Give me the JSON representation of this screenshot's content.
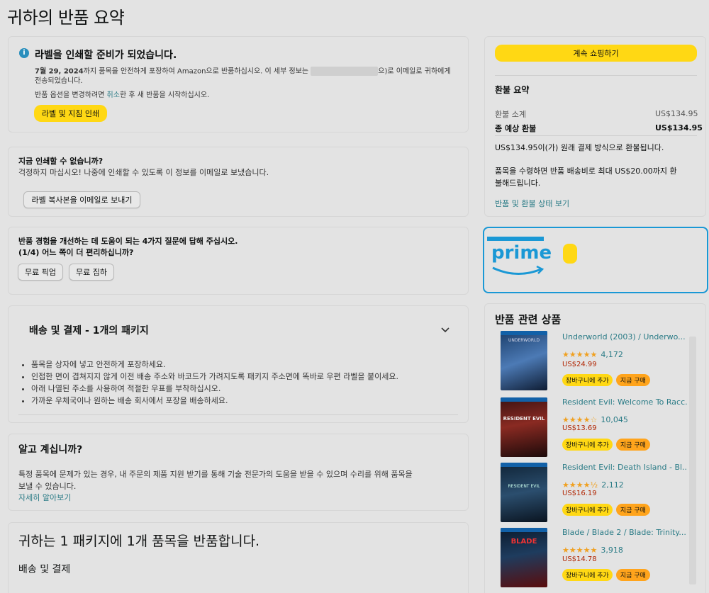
{
  "page": {
    "title": "귀하의 반품 요약"
  },
  "label_ready": {
    "heading": "라벨을 인쇄할 준비가 되었습니다.",
    "date": "7월 29, 2024",
    "line1_rest": "까지 품목을 안전하게 포장하여 Amazon으로 반품하십시오. 이 세부 정보는",
    "line1_end": "으)로 이메일로 귀하에게",
    "line2": "전송되었습니다.",
    "change_prefix": "반품 옵션을 변경하려면 ",
    "cancel_link": "취소",
    "change_suffix": "한 후 새 반품을 시작하십시오.",
    "print_button": "라벨 및 지침 인쇄"
  },
  "cant_print": {
    "heading": "지금 인쇄할 수 없습니까?",
    "text": "걱정하지 마십시오! 나중에 인쇄할 수 있도록 이 정보를 이메일로 보냈습니다.",
    "email_button": "라벨 복사본을 이메일로 보내기"
  },
  "survey": {
    "line1": "반품 경험을 개선하는 데 도움이 되는 4가지 질문에 답해 주십시오.",
    "line2": "(1/4) 어느 쪽이 더 편리하십니까?",
    "option1": "무료 픽업",
    "option2": "무료 집하"
  },
  "shipping": {
    "heading": "배송 및 결제 - 1개의 패키지",
    "bullets": [
      "품목을 상자에 넣고 안전하게 포장하세요.",
      "인접한 면이 겹쳐지지 않게 이전 배송 주소와 바코드가 가려지도록 패키지 주소면에 똑바로 우편 라벨을 붙이세요.",
      "아래 나열된 주소를 사용하여 적절한 우표를 부착하십시오.",
      "가까운 우체국이나 원하는 배송 회사에서 포장을 배송하세요."
    ]
  },
  "did_you_know": {
    "heading": "알고 계십니까?",
    "text1": "특정 품목에 문제가 있는 경우, 내 주문의 제품 지원 받기를 통해 기술 전문가의 도움을 받을 수 있으며 수리를 위해 품목을",
    "text2": "보낼 수 있습니다.",
    "link": "자세히 알아보기"
  },
  "returning": {
    "heading": "귀하는 1 패키지에 1개 품목을 반품합니다.",
    "sub": "배송 및 결제"
  },
  "summary": {
    "continue_button": "계속 쇼핑하기",
    "heading": "환불 요약",
    "subtotal_label": "환불 소계",
    "subtotal_value": "US$134.95",
    "total_label": "종 예상 환불",
    "total_value": "US$134.95",
    "refund_note": "US$134.95이(가) 원래 결제 방식으로 환불됩니다.",
    "shipping_note1": "품목을 수령하면 반품 배송비로 최대 US$20.00까지 환",
    "shipping_note2": "불해드립니다.",
    "status_link": "반품 및 환불 상태 보기"
  },
  "prime": {
    "logo_text": "prime"
  },
  "related": {
    "heading": "반품 관련 상품",
    "add_to_cart": "장바구니에 추가",
    "buy_now": "지금 구매",
    "products": [
      {
        "title": "Underworld (2003) / Underwo...",
        "stars": "★★★★★",
        "rating_count": "4,172",
        "price": "US$24.99",
        "cover_text": "UNDERWORLD"
      },
      {
        "title": "Resident Evil: Welcome To Racc...",
        "stars": "★★★★☆",
        "rating_count": "10,045",
        "price": "US$13.69",
        "cover_text": "RESIDENT EVIL"
      },
      {
        "title": "Resident Evil: Death Island - Bl...",
        "stars": "★★★★½",
        "rating_count": "2,112",
        "price": "US$16.19",
        "cover_text": "RESIDENT EVIL"
      },
      {
        "title": "Blade / Blade 2 / Blade: Trinity...",
        "stars": "★★★★★",
        "rating_count": "3,918",
        "price": "US$14.78",
        "cover_text": "BLADE"
      }
    ]
  },
  "colors": {
    "accent_yellow": "#ffd814",
    "link": "#2a7b86",
    "price": "#b12704",
    "prime_blue": "#1a98d5"
  }
}
